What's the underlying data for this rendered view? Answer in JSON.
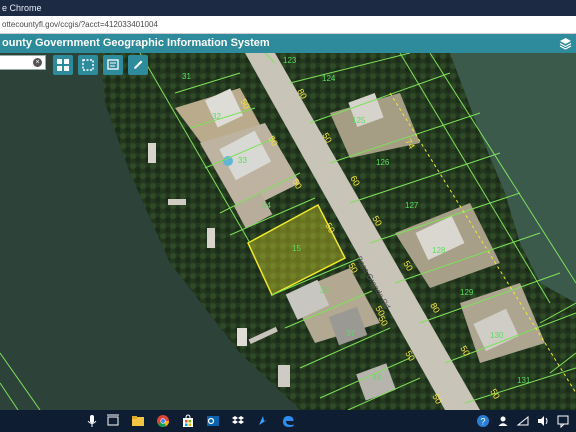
{
  "browser": {
    "title": "e Chrome",
    "url": "ottecountyfl.gov/ccgis/?acct=412033401004"
  },
  "gis": {
    "title": "ounty Government Geographic Information System"
  },
  "search": {
    "value": "",
    "clear_icon": "×"
  },
  "toolbar": {
    "tools": [
      "grid-icon",
      "select-icon",
      "notes-icon",
      "draw-icon"
    ]
  },
  "map": {
    "street_label": "Boca Grande Rd",
    "parcels": [
      "123",
      "124",
      "31",
      "32",
      "33",
      "125",
      "126",
      "127",
      "128",
      "129",
      "130",
      "131",
      "34",
      "15",
      "36",
      "37",
      "38"
    ],
    "dimensions": [
      "50",
      "80",
      "50",
      "50",
      "50",
      "60",
      "50",
      "50",
      "50",
      "50",
      "50",
      "80",
      "50",
      "50",
      "50",
      "50",
      "50",
      "74"
    ]
  },
  "taskbar": {
    "icons": [
      "windows-icon",
      "mic-icon",
      "task-view-icon",
      "file-explorer-icon",
      "chrome-icon",
      "store-icon",
      "outlook-icon",
      "dropbox-icon",
      "arrow-app-icon",
      "edge-icon"
    ],
    "tray_icons": [
      "help-icon",
      "people-icon",
      "network-icon",
      "volume-icon",
      "notification-icon"
    ]
  },
  "colors": {
    "accent": "#2e8b9b",
    "parcel_line": "#7ee05a",
    "selected_parcel": "#f0ea2a",
    "dimension_text": "#f2e33c",
    "parcel_number": "#58e05c"
  }
}
